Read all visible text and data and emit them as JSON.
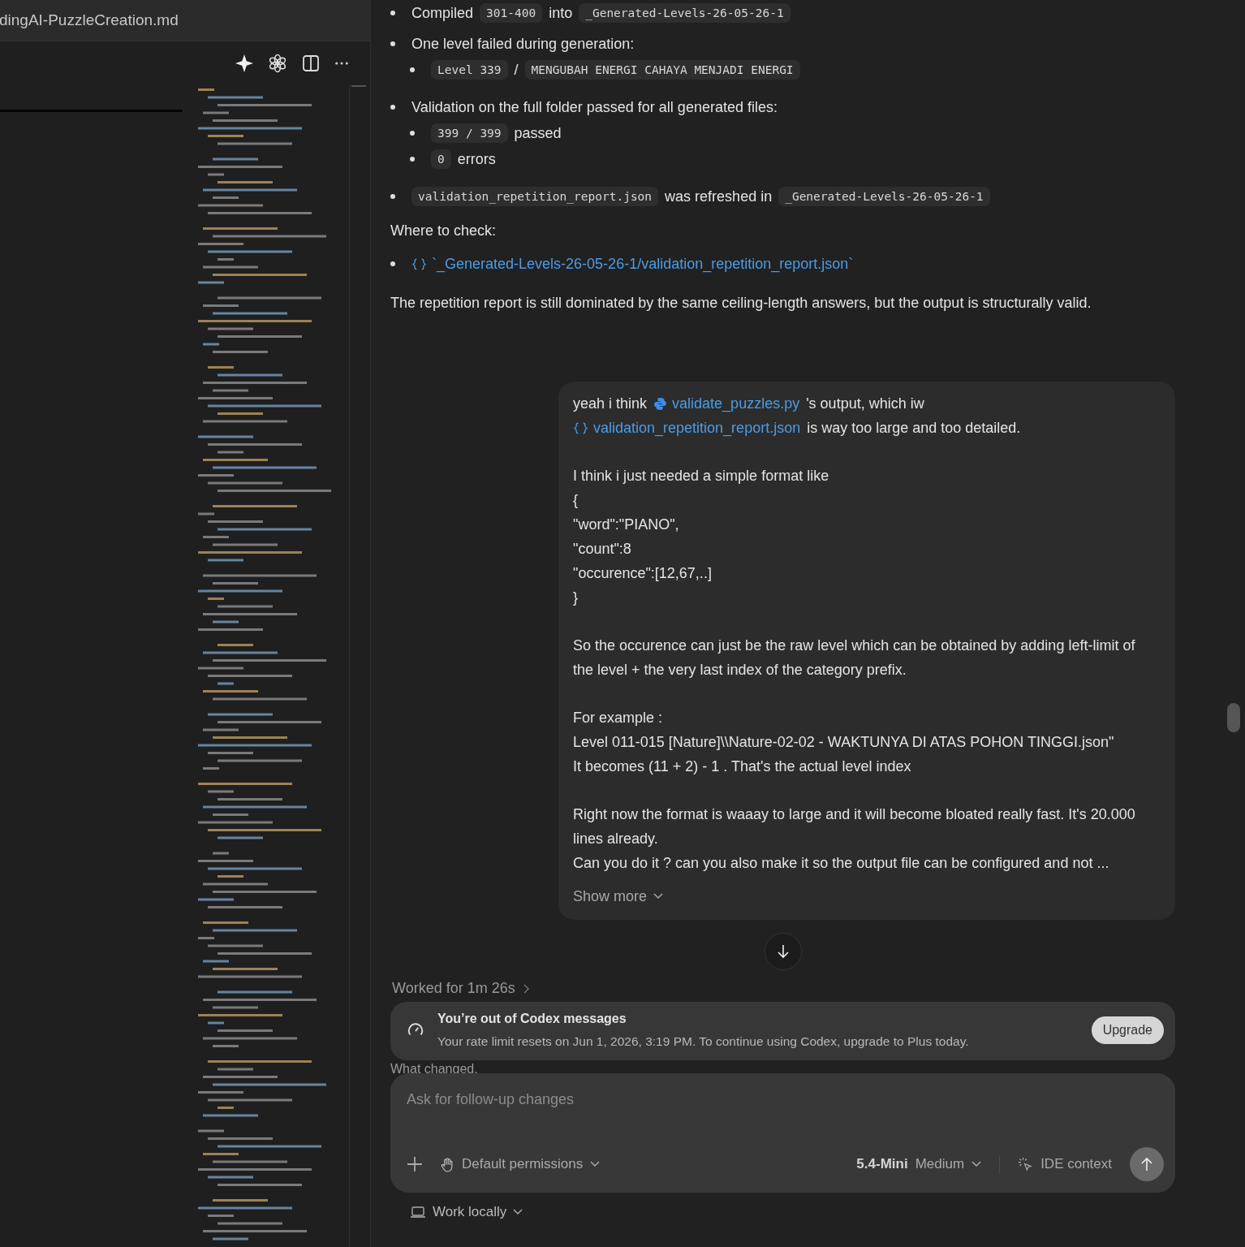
{
  "editor": {
    "tab_title": "dingAI-PuzzleCreation.md"
  },
  "summary": {
    "items": [
      {
        "segments": [
          {
            "kind": "text",
            "text": "Compiled"
          },
          {
            "kind": "code",
            "text": "301-400"
          },
          {
            "kind": "text",
            "text": "into"
          },
          {
            "kind": "code",
            "text": "_Generated-Levels-26-05-26-1"
          }
        ]
      },
      {
        "segments": [
          {
            "kind": "text",
            "text": "One level failed during generation:"
          }
        ],
        "children": [
          {
            "segments": [
              {
                "kind": "code",
                "text": "Level 339"
              },
              {
                "kind": "text",
                "text": "/"
              },
              {
                "kind": "code",
                "text": "MENGUBAH ENERGI CAHAYA MENJADI ENERGI"
              }
            ]
          }
        ]
      },
      {
        "segments": [
          {
            "kind": "text",
            "text": "Validation on the full folder passed for all generated files:"
          }
        ],
        "children": [
          {
            "segments": [
              {
                "kind": "code",
                "text": "399 / 399"
              },
              {
                "kind": "text",
                "text": "passed"
              }
            ]
          },
          {
            "segments": [
              {
                "kind": "code",
                "text": "0"
              },
              {
                "kind": "text",
                "text": "errors"
              }
            ]
          }
        ]
      },
      {
        "segments": [
          {
            "kind": "code",
            "text": "validation_repetition_report.json"
          },
          {
            "kind": "text",
            "text": "was refreshed in"
          },
          {
            "kind": "code",
            "text": "_Generated-Levels-26-05-26-1"
          }
        ]
      }
    ]
  },
  "where_to_check": {
    "heading": "Where to check:",
    "links": [
      {
        "kind": "json_file",
        "text": "`_Generated-Levels-26-05-26-1/validation_repetition_report.json`"
      }
    ]
  },
  "closing": "The repetition report is still dominated by the same ceiling-length answers, but the output is structurally valid.",
  "user_message": {
    "paragraphs": [
      [
        [
          {
            "kind": "text",
            "text": "yeah i think"
          },
          {
            "kind": "py_file",
            "text": "validate_puzzles.py"
          },
          {
            "kind": "text",
            "text": "'s output, which iw"
          }
        ],
        [
          {
            "kind": "json_file",
            "text": "validation_repetition_report.json"
          },
          {
            "kind": "text",
            "text": "is way too large and too detailed."
          }
        ]
      ],
      [
        [
          {
            "kind": "text",
            "text": "I think i just needed a simple format like"
          }
        ],
        [
          {
            "kind": "text",
            "text": "{"
          }
        ],
        [
          {
            "kind": "text",
            "text": "\"word\":\"PIANO\","
          }
        ],
        [
          {
            "kind": "text",
            "text": "\"count\":8"
          }
        ],
        [
          {
            "kind": "text",
            "text": "\"occurence\":[12,67,..]"
          }
        ],
        [
          {
            "kind": "text",
            "text": "}"
          }
        ]
      ],
      [
        [
          {
            "kind": "text",
            "text": "So the occurence can just be the raw level which can be obtained by adding left-limit of the level + the very last index of the category prefix."
          }
        ]
      ],
      [
        [
          {
            "kind": "text",
            "text": "For example :"
          }
        ],
        [
          {
            "kind": "text",
            "text": "Level 011-015 [Nature]\\\\Nature-02-02 - WAKTUNYA DI ATAS POHON TINGGI.json\""
          }
        ],
        [
          {
            "kind": "text",
            "text": "It becomes (11 + 2) - 1 . That's the actual level index"
          }
        ]
      ],
      [
        [
          {
            "kind": "text",
            "text": "Right now the format is waaay to large and it will become bloated really fast. It's 20.000 lines already."
          }
        ],
        [
          {
            "kind": "text",
            "text": "Can you do it ? can you also make it so the output file can be configured and not ..."
          }
        ]
      ]
    ],
    "show_more": "Show more"
  },
  "worked_for": "Worked for 1m 26s",
  "limit_banner": {
    "title": "You’re out of Codex messages",
    "body": "Your rate limit resets on Jun 1, 2026, 3:19 PM. To continue using Codex, upgrade to Plus today.",
    "button": "Upgrade"
  },
  "behind_text": "What changed.",
  "composer": {
    "placeholder": "Ask for follow-up changes",
    "permissions": "Default permissions",
    "model": "5.4-Mini",
    "effort": "Medium",
    "context": "IDE context"
  },
  "footer": {
    "work_mode": "Work locally"
  }
}
